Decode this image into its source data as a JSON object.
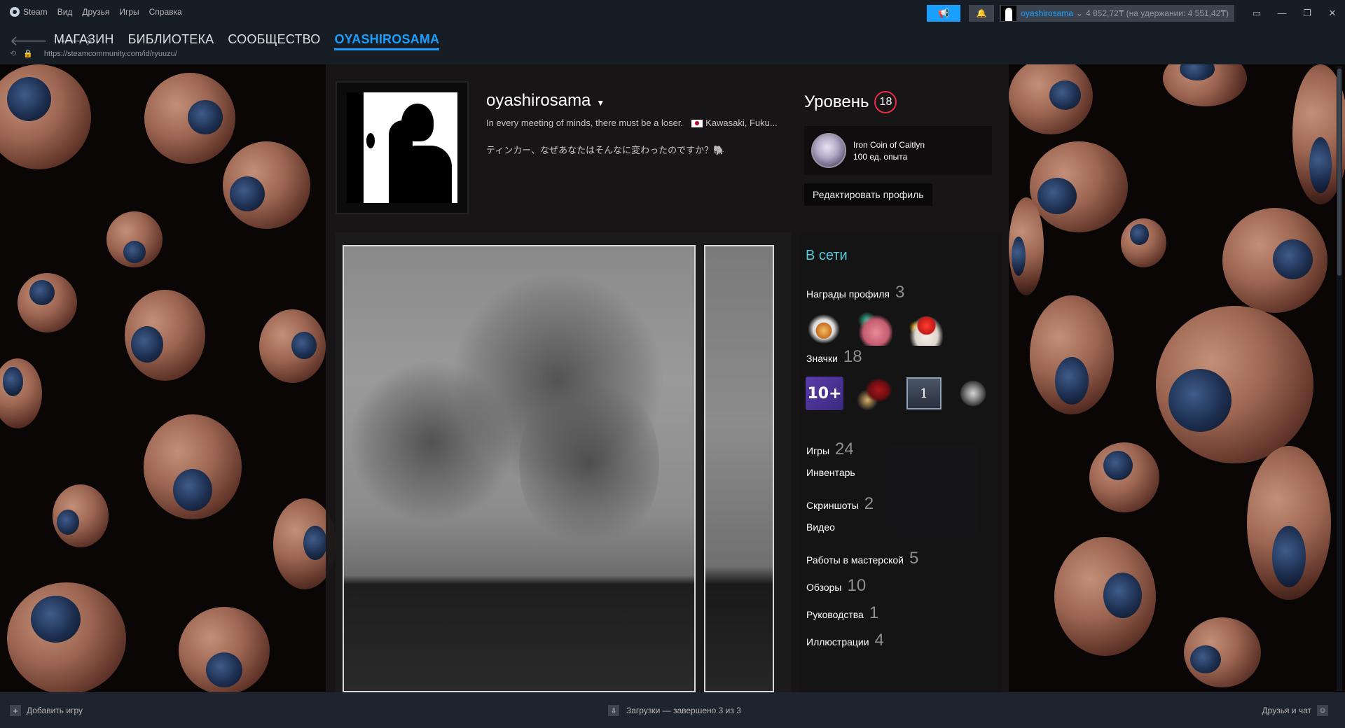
{
  "menu": {
    "app_name": "Steam",
    "items": [
      "Вид",
      "Друзья",
      "Игры",
      "Справка"
    ]
  },
  "account": {
    "name": "oyashirosama",
    "balance": "4 852,72₸ (на удержании: 4 551,42₸)"
  },
  "nav": {
    "tabs": [
      "МАГАЗИН",
      "БИБЛИОТЕКА",
      "СООБЩЕСТВО",
      "OYASHIROSAMA"
    ],
    "active_index": 3,
    "url": "https://steamcommunity.com/id/ryuuzu/"
  },
  "profile": {
    "persona_name": "oyashirosama",
    "summary": "In every meeting of minds, there must be a loser.",
    "location": "Kawasaki, Fuku...",
    "bio": "ティンカー、なぜあなたはそんなに変わったのですか？🐘",
    "level_label": "Уровень",
    "level": "18",
    "favorite_badge": {
      "name": "Iron Coin of Caitlyn",
      "xp": "100 ед. опыта"
    },
    "edit_button": "Редактировать профиль",
    "status": "В сети"
  },
  "sections": {
    "awards": {
      "label": "Награды профиля",
      "count": "3"
    },
    "badges": {
      "label": "Значки",
      "count": "18",
      "items": [
        "10+",
        "",
        "1",
        ""
      ]
    },
    "stats": [
      {
        "label": "Игры",
        "count": "24"
      },
      {
        "label": "Инвентарь",
        "count": ""
      },
      {
        "label": "Скриншоты",
        "count": "2"
      },
      {
        "label": "Видео",
        "count": ""
      },
      {
        "label": "Работы в мастерской",
        "count": "5"
      },
      {
        "label": "Обзоры",
        "count": "10"
      },
      {
        "label": "Руководства",
        "count": "1"
      },
      {
        "label": "Иллюстрации",
        "count": "4"
      }
    ]
  },
  "bottom": {
    "add_game": "Добавить игру",
    "downloads": "Загрузки — завершено 3 из 3",
    "friends": "Друзья и чат"
  },
  "colors": {
    "accent": "#1a9fff",
    "online": "#57cbde",
    "level_ring": "#e82d4a"
  }
}
